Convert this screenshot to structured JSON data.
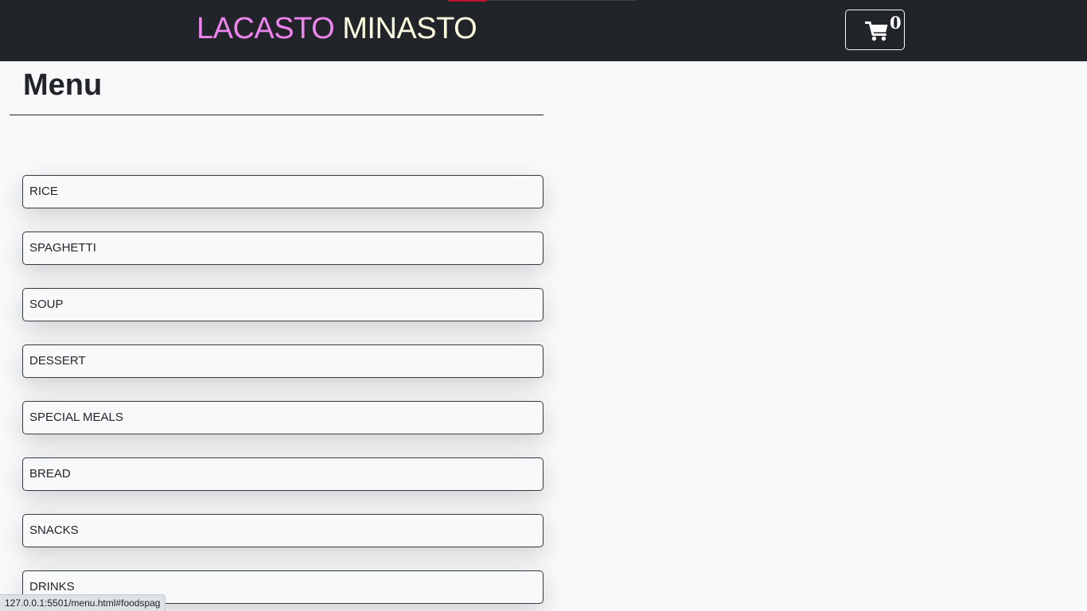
{
  "navbar": {
    "brand_part1": "LACASTO",
    "brand_part2": "MINASTO",
    "brand_colors": {
      "part1": "#ee82ee",
      "part2": "#fffde0"
    },
    "background_color": "#212529",
    "cart": {
      "icon": "shopping-cart-icon",
      "count": "0"
    }
  },
  "main": {
    "title": "Menu",
    "menu_items": [
      {
        "label": "RICE"
      },
      {
        "label": "SPAGHETTI"
      },
      {
        "label": "SOUP"
      },
      {
        "label": "DESSERT"
      },
      {
        "label": "SPECIAL MEALS"
      },
      {
        "label": "BREAD"
      },
      {
        "label": "SNACKS"
      },
      {
        "label": "DRINKS"
      }
    ]
  },
  "status_bar": {
    "url": "127.0.0.1:5501/menu.html#foodspag"
  }
}
